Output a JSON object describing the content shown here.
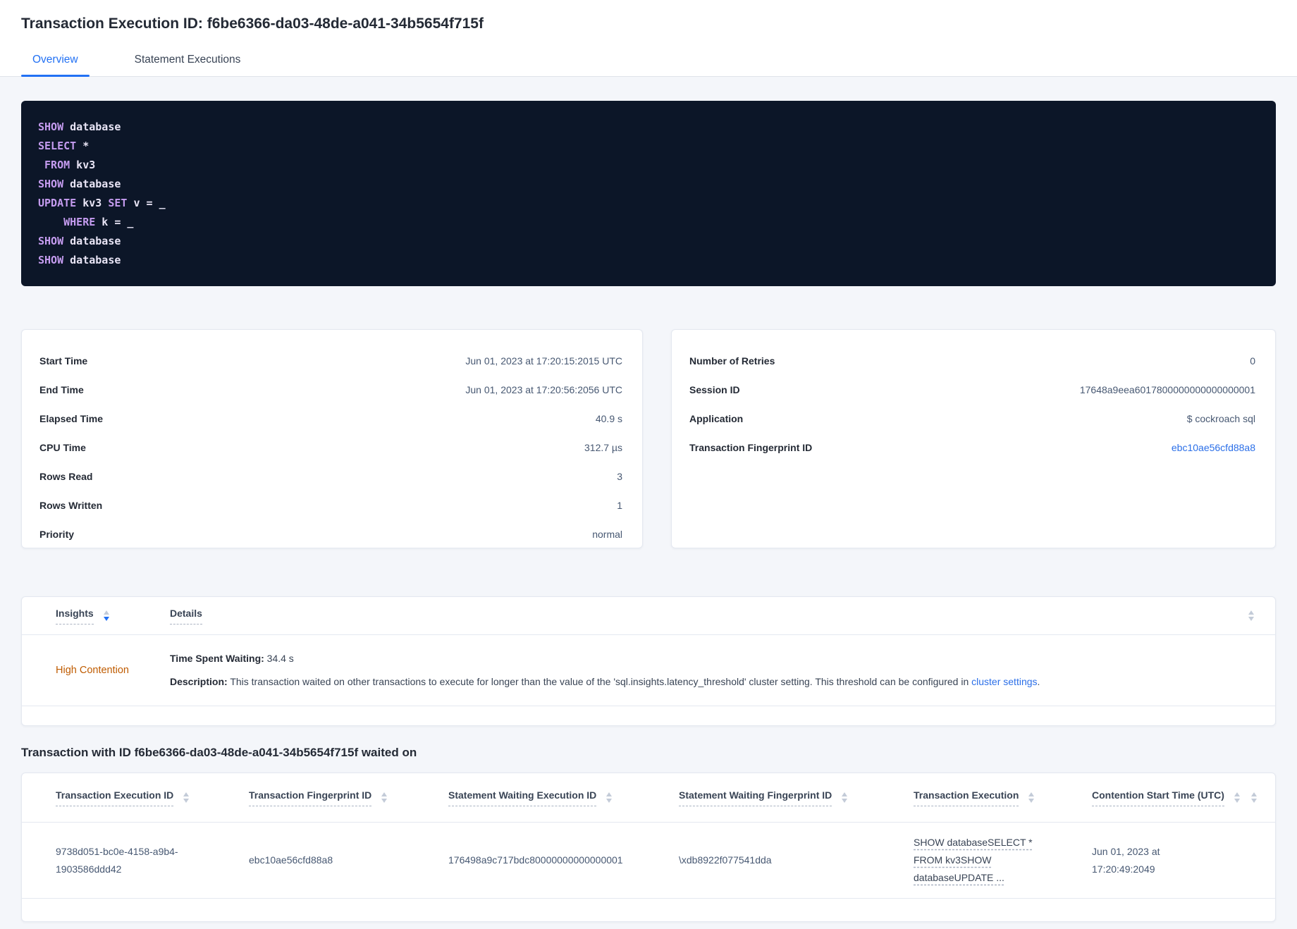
{
  "page": {
    "title": "Transaction Execution ID: f6be6366-da03-48de-a041-34b5654f715f"
  },
  "tabs": [
    {
      "label": "Overview",
      "active": true
    },
    {
      "label": "Statement Executions",
      "active": false
    }
  ],
  "sql_box": {
    "lines": [
      [
        {
          "t": "kw",
          "v": "SHOW"
        },
        {
          "t": "pl",
          "v": " database"
        }
      ],
      [
        {
          "t": "kw",
          "v": "SELECT"
        },
        {
          "t": "pl",
          "v": " *"
        }
      ],
      [
        {
          "t": "pl",
          "v": " "
        },
        {
          "t": "kw",
          "v": "FROM"
        },
        {
          "t": "pl",
          "v": " kv3"
        }
      ],
      [
        {
          "t": "kw",
          "v": "SHOW"
        },
        {
          "t": "pl",
          "v": " database"
        }
      ],
      [
        {
          "t": "kw",
          "v": "UPDATE"
        },
        {
          "t": "pl",
          "v": " kv3 "
        },
        {
          "t": "kw",
          "v": "SET"
        },
        {
          "t": "pl",
          "v": " v = _"
        }
      ],
      [
        {
          "t": "pl",
          "v": "    "
        },
        {
          "t": "kw",
          "v": "WHERE"
        },
        {
          "t": "pl",
          "v": " k = _"
        }
      ],
      [
        {
          "t": "kw",
          "v": "SHOW"
        },
        {
          "t": "pl",
          "v": " database"
        }
      ],
      [
        {
          "t": "kw",
          "v": "SHOW"
        },
        {
          "t": "pl",
          "v": " database"
        }
      ]
    ]
  },
  "summary_left": {
    "rows": [
      {
        "label": "Start Time",
        "value": "Jun 01, 2023 at 17:20:15:2015 UTC"
      },
      {
        "label": "End Time",
        "value": "Jun 01, 2023 at 17:20:56:2056 UTC"
      },
      {
        "label": "Elapsed Time",
        "value": "40.9 s"
      },
      {
        "label": "CPU Time",
        "value": "312.7 µs"
      },
      {
        "label": "Rows Read",
        "value": "3"
      },
      {
        "label": "Rows Written",
        "value": "1"
      },
      {
        "label": "Priority",
        "value": "normal"
      }
    ]
  },
  "summary_right": {
    "rows": [
      {
        "label": "Number of Retries",
        "value": "0"
      },
      {
        "label": "Session ID",
        "value": "17648a9eea6017800000000000000001"
      },
      {
        "label": "Application",
        "value": "$ cockroach sql"
      },
      {
        "label": "Transaction Fingerprint ID",
        "value": "ebc10ae56cfd88a8",
        "link": true
      }
    ]
  },
  "insights_table": {
    "headers": [
      {
        "label": "Insights",
        "sorted": "desc"
      },
      {
        "label": "Details",
        "sorted": null
      }
    ],
    "row": {
      "insight": "High Contention",
      "waiting_label": "Time Spent Waiting:",
      "waiting_value": "34.4 s",
      "description_label": "Description:",
      "description_text": "This transaction waited on other transactions to execute for longer than the value of the 'sql.insights.latency_threshold' cluster setting. This threshold can be configured in",
      "description_link": "cluster settings",
      "description_suffix": "."
    }
  },
  "waited_on": {
    "heading": "Transaction with ID f6be6366-da03-48de-a041-34b5654f715f waited on",
    "headers": [
      "Transaction Execution ID",
      "Transaction Fingerprint ID",
      "Statement Waiting Execution ID",
      "Statement Waiting Fingerprint ID",
      "Transaction Execution",
      "Contention Start Time (UTC)"
    ],
    "row": {
      "transaction_execution_id": "9738d051-bc0e-4158-a9b4-1903586ddd42",
      "transaction_fingerprint_id": "ebc10ae56cfd88a8",
      "statement_waiting_execution_id": "176498a9c717bdc80000000000000001",
      "statement_waiting_fingerprint_id": "\\xdb8922f077541dda",
      "transaction_execution": "SHOW databaseSELECT * FROM kv3SHOW databaseUPDATE ...",
      "contention_start_time": "Jun 01, 2023 at 17:20:49:2049"
    }
  },
  "colors": {
    "accent_blue": "#2271f4",
    "link_blue": "#2b6fe8",
    "insight_orange": "#bf5b00",
    "code_background": "#0c1628",
    "code_keyword": "#c59cf0",
    "code_plain": "#e9e5f6"
  }
}
